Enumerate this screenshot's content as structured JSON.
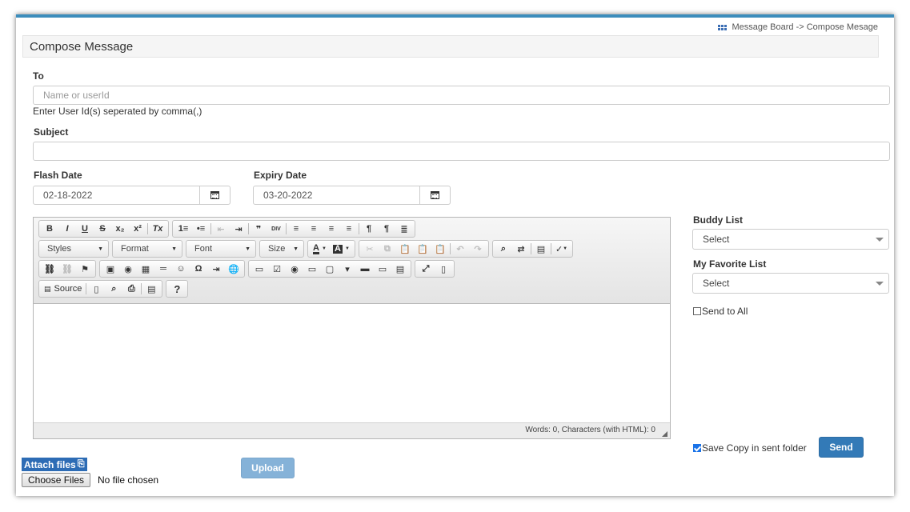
{
  "breadcrumb": {
    "text": "Message Board -> Compose Mesage"
  },
  "panel": {
    "title": "Compose Message"
  },
  "form": {
    "to_label": "To",
    "to_placeholder": "Name or userId",
    "to_help": "Enter User Id(s) seperated by comma(,)",
    "subject_label": "Subject",
    "subject_value": "",
    "flash_label": "Flash Date",
    "flash_value": "02-18-2022",
    "expiry_label": "Expiry Date",
    "expiry_value": "03-20-2022"
  },
  "editor": {
    "row1": [
      "B",
      "I",
      "U",
      "S",
      "x₂",
      "x²",
      "Tx",
      "1≡",
      "•≡",
      "⇤",
      "⇥",
      "❞",
      "DIV",
      "≡",
      "≡",
      "≡",
      "≡",
      "¶",
      "¶",
      "≣"
    ],
    "styles_label": "Styles",
    "format_label": "Format",
    "font_label": "Font",
    "size_label": "Size",
    "source_label": "Source",
    "help_label": "?",
    "status": "Words: 0, Characters (with HTML): 0"
  },
  "side": {
    "buddy_label": "Buddy List",
    "buddy_value": "Select",
    "favorite_label": "My Favorite List",
    "favorite_value": "Select",
    "send_all_label": "Send to All",
    "save_copy_label": "Save Copy in sent folder",
    "send_label": "Send"
  },
  "files": {
    "attach_label": "Attach files",
    "choose_label": "Choose Files",
    "status": "No file chosen",
    "upload_label": "Upload"
  }
}
